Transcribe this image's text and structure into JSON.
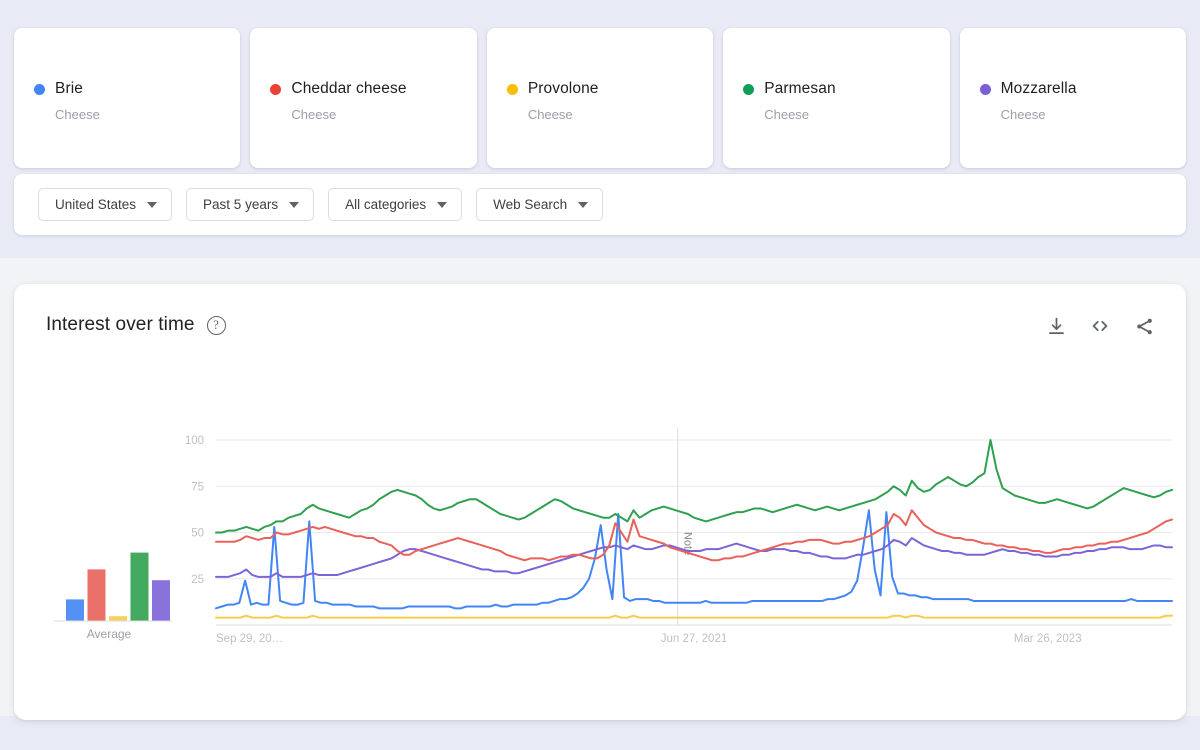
{
  "terms": [
    {
      "name": "Brie",
      "subtitle": "Cheese",
      "color": "#4285F4"
    },
    {
      "name": "Cheddar cheese",
      "subtitle": "Cheese",
      "color": "#EA4335"
    },
    {
      "name": "Provolone",
      "subtitle": "Cheese",
      "color": "#FBBC04"
    },
    {
      "name": "Parmesan",
      "subtitle": "Cheese",
      "color": "#0F9D58"
    },
    {
      "name": "Mozzarella",
      "subtitle": "Cheese",
      "color": "#7B5FD6"
    }
  ],
  "filters": [
    {
      "label": "United States",
      "icon": "chevron-down-icon"
    },
    {
      "label": "Past 5 years",
      "icon": "chevron-down-icon"
    },
    {
      "label": "All categories",
      "icon": "chevron-down-icon"
    },
    {
      "label": "Web Search",
      "icon": "chevron-down-icon"
    }
  ],
  "chart_card": {
    "title": "Interest over time",
    "help_icon": "help-circle-icon",
    "actions": [
      {
        "name": "download-icon",
        "tooltip": "Download"
      },
      {
        "name": "embed-code-icon",
        "tooltip": "Embed"
      },
      {
        "name": "share-icon",
        "tooltip": "Share"
      }
    ]
  },
  "average_panel": {
    "label": "Average",
    "values": [
      18,
      43,
      4,
      57,
      34
    ]
  },
  "chart_data": {
    "type": "line",
    "title": "Interest over time",
    "xlabel": "",
    "ylabel": "",
    "ylim": [
      0,
      100
    ],
    "yticks": [
      25,
      50,
      75,
      100
    ],
    "ytick_labels": [
      "25",
      "50",
      "75",
      "100"
    ],
    "grid": true,
    "legend_position": "top-cards",
    "xtick_labels": [
      "Sep 29, 20…",
      "Jun 27, 2021",
      "Mar 26, 2023"
    ],
    "xtick_positions": [
      0.0,
      0.5,
      0.87
    ],
    "annotation": {
      "label": "Note",
      "x_fraction": 0.483,
      "rotated": true
    },
    "series": [
      {
        "name": "Brie",
        "color": "#4285F4",
        "values": [
          9,
          10,
          11,
          11,
          12,
          24,
          11,
          12,
          11,
          11,
          53,
          13,
          12,
          11,
          11,
          12,
          56,
          13,
          12,
          12,
          11,
          11,
          11,
          11,
          10,
          10,
          10,
          10,
          9,
          9,
          9,
          9,
          9,
          10,
          10,
          10,
          10,
          10,
          10,
          10,
          10,
          9,
          9,
          10,
          10,
          10,
          10,
          10,
          11,
          10,
          10,
          11,
          11,
          11,
          11,
          11,
          12,
          12,
          13,
          14,
          14,
          15,
          17,
          20,
          25,
          36,
          54,
          30,
          14,
          60,
          15,
          13,
          14,
          14,
          14,
          13,
          13,
          12,
          12,
          12,
          12,
          12,
          12,
          12,
          13,
          12,
          12,
          12,
          12,
          12,
          12,
          12,
          13,
          13,
          13,
          13,
          13,
          13,
          13,
          13,
          13,
          13,
          13,
          13,
          13,
          14,
          14,
          15,
          16,
          18,
          24,
          42,
          62,
          30,
          16,
          61,
          26,
          17,
          17,
          16,
          16,
          15,
          15,
          14,
          14,
          14,
          14,
          14,
          14,
          14,
          13,
          13,
          13,
          13,
          13,
          13,
          13,
          13,
          13,
          13,
          13,
          13,
          13,
          13,
          13,
          13,
          13,
          13,
          13,
          13,
          13,
          13,
          13,
          13,
          13,
          13,
          13,
          14,
          13,
          13,
          13,
          13,
          13,
          13,
          13
        ]
      },
      {
        "name": "Cheddar cheese",
        "color": "#E8615A",
        "values": [
          45,
          45,
          45,
          45,
          46,
          48,
          47,
          46,
          47,
          47,
          50,
          49,
          49,
          50,
          51,
          52,
          53,
          52,
          53,
          52,
          51,
          50,
          49,
          48,
          48,
          47,
          47,
          45,
          44,
          43,
          40,
          38,
          38,
          40,
          41,
          42,
          43,
          44,
          45,
          46,
          47,
          46,
          45,
          44,
          43,
          42,
          41,
          40,
          38,
          37,
          36,
          35,
          36,
          36,
          36,
          35,
          36,
          37,
          37,
          38,
          38,
          37,
          36,
          36,
          38,
          43,
          55,
          50,
          45,
          57,
          48,
          47,
          46,
          45,
          44,
          42,
          41,
          40,
          39,
          38,
          37,
          36,
          35,
          35,
          36,
          36,
          37,
          37,
          38,
          39,
          40,
          41,
          42,
          43,
          44,
          44,
          45,
          45,
          46,
          46,
          46,
          45,
          44,
          44,
          45,
          45,
          46,
          47,
          48,
          50,
          52,
          54,
          60,
          58,
          54,
          62,
          58,
          54,
          52,
          50,
          49,
          48,
          47,
          47,
          46,
          46,
          45,
          44,
          44,
          43,
          43,
          42,
          42,
          41,
          41,
          40,
          40,
          39,
          39,
          40,
          41,
          41,
          42,
          42,
          43,
          43,
          44,
          44,
          45,
          45,
          46,
          47,
          48,
          49,
          50,
          52,
          54,
          56,
          57
        ]
      },
      {
        "name": "Provolone",
        "color": "#F7CB4D",
        "values": [
          4,
          4,
          4,
          4,
          4,
          5,
          4,
          4,
          4,
          4,
          5,
          4,
          4,
          4,
          4,
          4,
          5,
          4,
          4,
          4,
          4,
          4,
          4,
          4,
          4,
          4,
          4,
          4,
          4,
          4,
          4,
          4,
          4,
          4,
          4,
          4,
          4,
          4,
          4,
          4,
          4,
          4,
          4,
          4,
          4,
          4,
          4,
          4,
          4,
          4,
          4,
          4,
          4,
          4,
          4,
          4,
          4,
          4,
          4,
          4,
          4,
          4,
          4,
          4,
          4,
          4,
          5,
          4,
          4,
          5,
          4,
          4,
          4,
          4,
          4,
          4,
          4,
          4,
          4,
          4,
          4,
          4,
          4,
          4,
          4,
          4,
          4,
          4,
          4,
          4,
          4,
          4,
          4,
          4,
          4,
          4,
          4,
          4,
          4,
          4,
          4,
          4,
          4,
          4,
          4,
          4,
          4,
          4,
          4,
          4,
          4,
          4,
          5,
          5,
          4,
          5,
          5,
          4,
          4,
          4,
          4,
          4,
          4,
          4,
          4,
          4,
          4,
          4,
          4,
          4,
          4,
          4,
          4,
          4,
          4,
          4,
          4,
          4,
          4,
          4,
          4,
          4,
          4,
          4,
          4,
          4,
          4,
          4,
          4,
          4,
          4,
          4,
          4,
          4,
          4,
          4,
          4,
          5,
          5
        ]
      },
      {
        "name": "Parmesan",
        "color": "#2EA04E",
        "values": [
          50,
          50,
          51,
          51,
          52,
          53,
          52,
          51,
          53,
          54,
          56,
          56,
          58,
          59,
          60,
          63,
          65,
          63,
          62,
          61,
          60,
          59,
          58,
          60,
          62,
          63,
          65,
          68,
          70,
          72,
          73,
          72,
          71,
          70,
          68,
          65,
          63,
          62,
          63,
          64,
          66,
          67,
          68,
          68,
          66,
          64,
          62,
          60,
          59,
          58,
          57,
          58,
          60,
          62,
          64,
          66,
          68,
          67,
          65,
          63,
          62,
          61,
          60,
          59,
          58,
          58,
          60,
          58,
          56,
          62,
          58,
          60,
          62,
          63,
          64,
          63,
          62,
          61,
          60,
          58,
          57,
          56,
          57,
          58,
          59,
          60,
          61,
          61,
          62,
          63,
          63,
          62,
          61,
          62,
          63,
          64,
          65,
          64,
          63,
          62,
          63,
          64,
          63,
          62,
          63,
          64,
          65,
          66,
          67,
          68,
          70,
          72,
          75,
          73,
          70,
          78,
          74,
          72,
          73,
          76,
          78,
          80,
          78,
          76,
          75,
          77,
          80,
          82,
          100,
          84,
          74,
          72,
          70,
          69,
          68,
          67,
          66,
          66,
          67,
          68,
          67,
          66,
          65,
          64,
          63,
          64,
          66,
          68,
          70,
          72,
          74,
          73,
          72,
          71,
          70,
          69,
          70,
          72,
          73
        ]
      },
      {
        "name": "Mozzarella",
        "color": "#7D63D8",
        "values": [
          26,
          26,
          26,
          27,
          28,
          30,
          27,
          26,
          26,
          26,
          28,
          26,
          26,
          26,
          26,
          27,
          28,
          27,
          27,
          27,
          27,
          28,
          29,
          30,
          31,
          32,
          33,
          34,
          35,
          36,
          38,
          40,
          41,
          41,
          40,
          39,
          38,
          37,
          36,
          35,
          34,
          33,
          32,
          31,
          30,
          30,
          29,
          29,
          29,
          28,
          28,
          29,
          30,
          31,
          32,
          33,
          34,
          35,
          36,
          37,
          38,
          39,
          40,
          41,
          42,
          42,
          43,
          42,
          41,
          43,
          42,
          41,
          41,
          42,
          43,
          43,
          42,
          41,
          40,
          40,
          40,
          41,
          41,
          41,
          42,
          43,
          44,
          43,
          42,
          41,
          40,
          40,
          41,
          41,
          41,
          40,
          40,
          39,
          39,
          38,
          37,
          37,
          36,
          36,
          36,
          37,
          38,
          38,
          39,
          40,
          41,
          43,
          46,
          45,
          43,
          47,
          45,
          43,
          42,
          41,
          40,
          40,
          39,
          39,
          38,
          38,
          38,
          38,
          39,
          40,
          41,
          40,
          40,
          39,
          39,
          38,
          38,
          37,
          37,
          37,
          38,
          38,
          39,
          39,
          40,
          40,
          41,
          41,
          42,
          42,
          42,
          41,
          41,
          41,
          42,
          43,
          43,
          42,
          42
        ]
      }
    ]
  }
}
